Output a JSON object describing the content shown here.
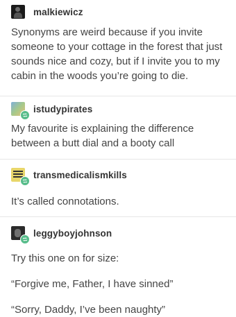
{
  "posts": [
    {
      "username": "malkiewicz",
      "avatar_icon": "user-avatar-icon",
      "reblogged": false,
      "paragraphs": [
        "Synonyms are weird because if you invite someone to your cottage in the forest that just sounds nice and cozy, but if I invite you to my cabin in the woods you’re going to die."
      ]
    },
    {
      "username": "istudypirates",
      "avatar_icon": "user-avatar-icon",
      "reblogged": true,
      "paragraphs": [
        "My favourite is explaining the difference between a butt dial and a booty call"
      ]
    },
    {
      "username": "transmedicalismkills",
      "avatar_icon": "user-avatar-icon",
      "reblogged": true,
      "paragraphs": [
        "It’s called connotations."
      ]
    },
    {
      "username": "leggyboyjohnson",
      "avatar_icon": "user-avatar-icon",
      "reblogged": true,
      "paragraphs": [
        "Try this one on for size:",
        "“Forgive me, Father, I have sinned”",
        "“Sorry, Daddy, I’ve been naughty”"
      ]
    }
  ],
  "colors": {
    "reblog_badge": "#56bc8a",
    "text": "#444444",
    "separator": "#e6e6e6"
  }
}
